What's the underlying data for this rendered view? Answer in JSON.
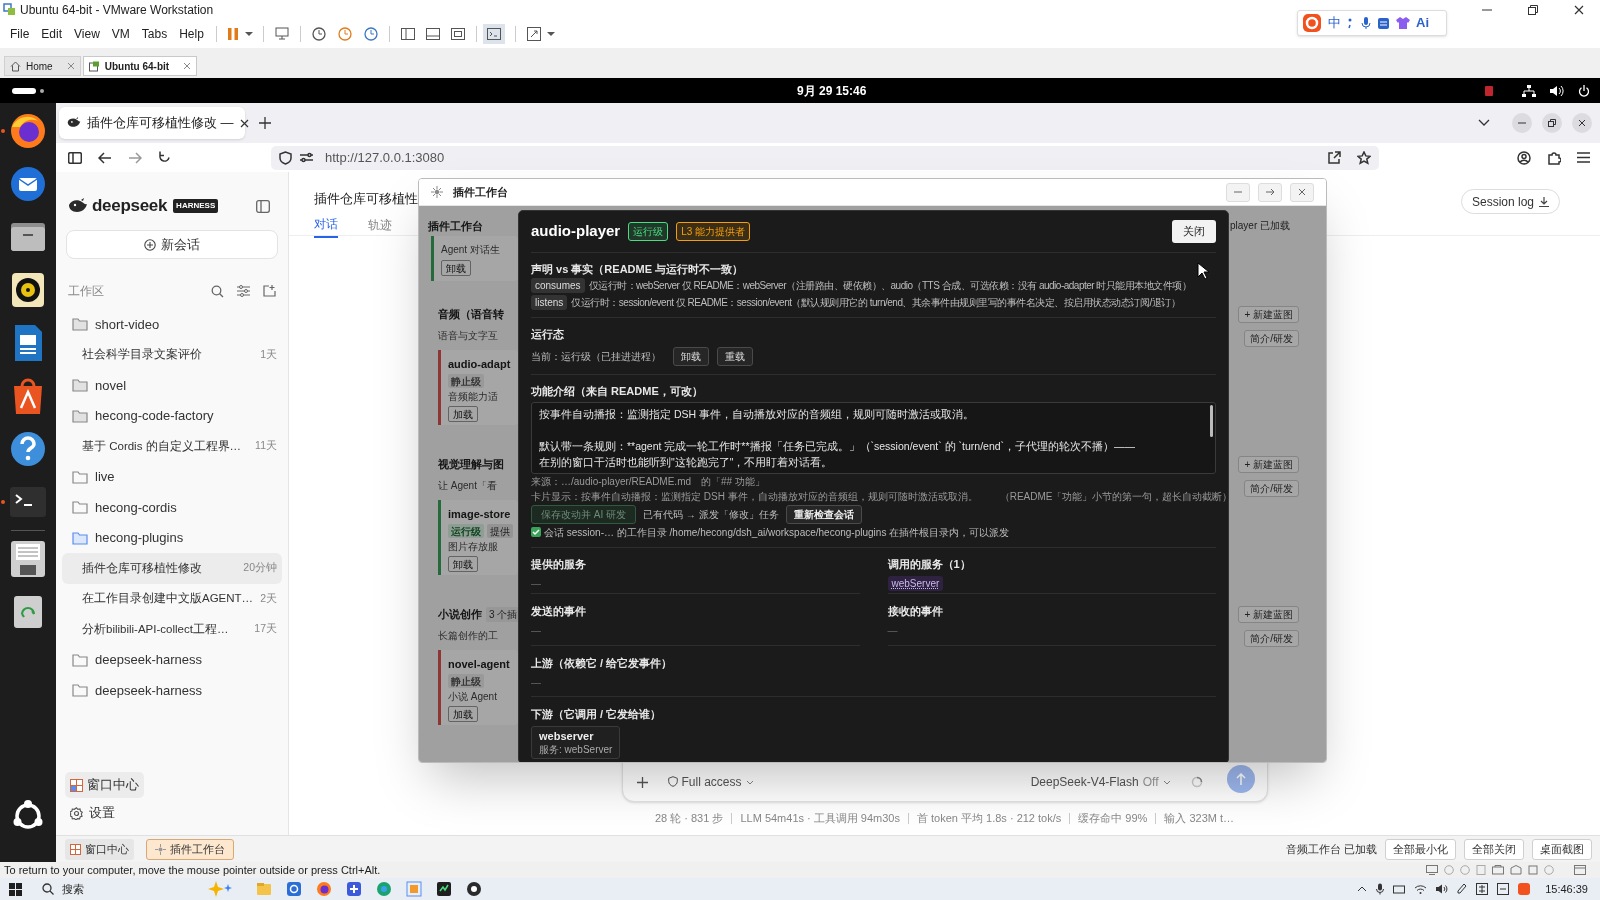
{
  "vm_window": {
    "title": "Ubuntu 64-bit - VMware Workstation",
    "menu": [
      "File",
      "Edit",
      "View",
      "VM",
      "Tabs",
      "Help"
    ],
    "tabs": [
      {
        "label": "Home",
        "selected": false
      },
      {
        "label": "Ubuntu 64-bit",
        "selected": true
      }
    ],
    "ime_bar": {
      "mode": "中",
      "ai": "Ai"
    }
  },
  "ubuntu_topbar": {
    "clock": "9月 29 15:46"
  },
  "dock": {
    "apps": [
      {
        "kind": "firefox",
        "running": true
      },
      {
        "kind": "thunderbird",
        "running": false
      },
      {
        "kind": "files",
        "running": false
      },
      {
        "kind": "rhythmbox",
        "running": false
      },
      {
        "kind": "writer",
        "running": false
      },
      {
        "kind": "appcenter",
        "running": false
      },
      {
        "kind": "help",
        "running": false
      },
      {
        "kind": "terminal",
        "running": true
      },
      {
        "kind": "floppy",
        "running": false
      },
      {
        "kind": "trash",
        "running": false
      }
    ]
  },
  "browser": {
    "tab_title": "插件仓库可移植性修改 —",
    "url": "http://127.0.0.1:3080"
  },
  "sidebar": {
    "brand": "deepseek",
    "brand_badge": "HARNESS",
    "new_chat": "新会话",
    "workspace_label": "工作区",
    "folders": [
      {
        "name": "short-video",
        "kind": "filled",
        "children": [
          {
            "title": "社会科学目录文案评价",
            "age": "1天",
            "selected": false
          }
        ]
      },
      {
        "name": "novel",
        "kind": "filled"
      },
      {
        "name": "hecong-code-factory",
        "kind": "filled",
        "children": [
          {
            "title": "基于 Cordis 的自定义工程界…",
            "age": "11天",
            "selected": false
          }
        ]
      },
      {
        "name": "live",
        "kind": "outline"
      },
      {
        "name": "hecong-cordis",
        "kind": "outline"
      },
      {
        "name": "hecong-plugins",
        "kind": "active",
        "children": [
          {
            "title": "插件仓库可移植性修改",
            "age": "20分钟",
            "selected": true
          },
          {
            "title": "在工作目录创建中文版AGENT…",
            "age": "2天",
            "selected": false
          },
          {
            "title": "分析bilibili-API-collect工程…",
            "age": "17天",
            "selected": false
          }
        ]
      },
      {
        "name": "deepseek-harness",
        "kind": "outline"
      },
      {
        "name": "deepseek-harness",
        "kind": "outline"
      }
    ],
    "footer": [
      {
        "label": "窗口中心",
        "kind": "windows"
      },
      {
        "label": "设置",
        "kind": "settings"
      }
    ]
  },
  "main": {
    "title": "插件仓库可移植性",
    "tabs": [
      {
        "label": "对话",
        "selected": true
      },
      {
        "label": "轨迹",
        "selected": false
      }
    ],
    "session_log": "Session log"
  },
  "composer": {
    "access": "Full access",
    "model": "DeepSeek-V4-Flash",
    "thinking": "Off"
  },
  "stats": [
    "28 轮 · 831 步",
    "LLM 54m41s · 工具调用 94m30s",
    "首 token 平均 1.8s · 212 tok/s",
    "缓存命中 99%",
    "输入 323M t…"
  ],
  "app_bar": {
    "windows": [
      {
        "label": "窗口中心",
        "selected": false
      },
      {
        "label": "插件工作台",
        "selected": true
      }
    ],
    "status": "音频工作台 已加载",
    "actions": [
      "全部最小化",
      "全部关闭",
      "桌面截图"
    ]
  },
  "workbench": {
    "title": "插件工作台",
    "header": "插件工作台",
    "status": "player 已加载",
    "top_card": {
      "text": "Agent 对话生",
      "button": "卸载",
      "kind": "running"
    },
    "groups": [
      {
        "title": "音频（语音转",
        "subtitle": "语音与文字互",
        "actions": [
          "+ 新建蓝图",
          "简介/研发"
        ],
        "plugin": {
          "name": "audio-adapt",
          "state": "静止级",
          "kind": "stopped",
          "note": "音频能力适",
          "button": "加载"
        }
      },
      {
        "title": "视觉理解与图",
        "subtitle": "让 Agent「看",
        "actions": [
          "+ 新建蓝图",
          "简介/研发"
        ],
        "plugin": {
          "name": "image-store",
          "state": "运行级",
          "kind": "running",
          "tag": "提供",
          "note": "图片存放服",
          "button": "卸载"
        }
      },
      {
        "title": "小说创作",
        "badge": "3 个插",
        "subtitle": "长篇创作的工",
        "actions": [
          "+ 新建蓝图",
          "简介/研发"
        ],
        "plugin": {
          "name": "novel-agent",
          "state": "静止级",
          "kind": "stopped",
          "note": "小说 Agent",
          "button": "加载"
        }
      }
    ]
  },
  "modal": {
    "title": "audio-player",
    "badges": [
      {
        "label": "运行级",
        "color": "#4ade80"
      },
      {
        "label": "L3 能力提供者",
        "color": "#f59e0b"
      }
    ],
    "close": "关闭",
    "mismatch": {
      "title": "声明 vs 事实（README 与运行时不一致）",
      "rows": [
        {
          "tag": "consumes",
          "text": "仅运行时：webServer 仅 README：webServer（注册路由、硬依赖）、audio（TTS 合成、可选依赖：没有 audio-adapter 时只能用本地文件项）"
        },
        {
          "tag": "listens",
          "text": "仅运行时：session/event 仅 README：session/event（默认规则用它的 turn/end、其余事件由规则里写的事件名决定、按启用状态动态订阅/退订）"
        }
      ]
    },
    "runtime": {
      "title": "运行态",
      "current": "当前：运行级（已挂进进程）",
      "buttons": [
        "卸载",
        "重载"
      ]
    },
    "description": {
      "title": "功能介绍（来自 README，可改）",
      "lines": [
        "按事件自动播报：监测指定 DSH 事件，自动播放对应的音频组，规则可随时激活或取消。",
        "默认带一条规则：**agent 完成一轮工作时**播报「任务已完成。」（`session/event` 的 `turn/end`，子代理的轮次不播）——",
        "在别的窗口干活时也能听到\"这轮跑完了\"，不用盯着对话看。"
      ],
      "source": "来源：…/audio-player/README.md　的「## 功能」",
      "card_preview": "卡片显示：按事件自动播报：监测指定 DSH 事件，自动播放对应的音频组，规则可随时激活或取消。",
      "card_note": "（README「功能」小节的第一句，超长自动截断）",
      "save_button": {
        "label": "保存改动并 AI 研发",
        "disabled": true
      },
      "dispatch_note": "已有代码 → 派发「修改」任务",
      "recheck_button": "重新检查会话",
      "workdir": {
        "checked": true,
        "text": "会话 session-… 的工作目录 /home/hecong/dsh_ai/workspace/hecong-plugins 在插件根目录内，可以派发"
      }
    },
    "relations": [
      {
        "title": "提供的服务",
        "empty": "—"
      },
      {
        "title": "调用的服务（1）",
        "links": [
          "webServer"
        ]
      },
      {
        "title": "发送的事件",
        "empty": "—"
      },
      {
        "title": "接收的事件",
        "empty": "—"
      }
    ],
    "upstream": {
      "title": "上游（依赖它 / 给它发事件）",
      "empty": "—"
    },
    "downstream": {
      "title": "下游（它调用 / 它发给谁）",
      "cards": [
        {
          "name": "webserver",
          "detail": "服务: webServer"
        }
      ]
    }
  },
  "os_hint": "To return to your computer, move the mouse pointer outside or press Ctrl+Alt.",
  "taskbar": {
    "search": "搜索",
    "time": "15:46:39"
  }
}
